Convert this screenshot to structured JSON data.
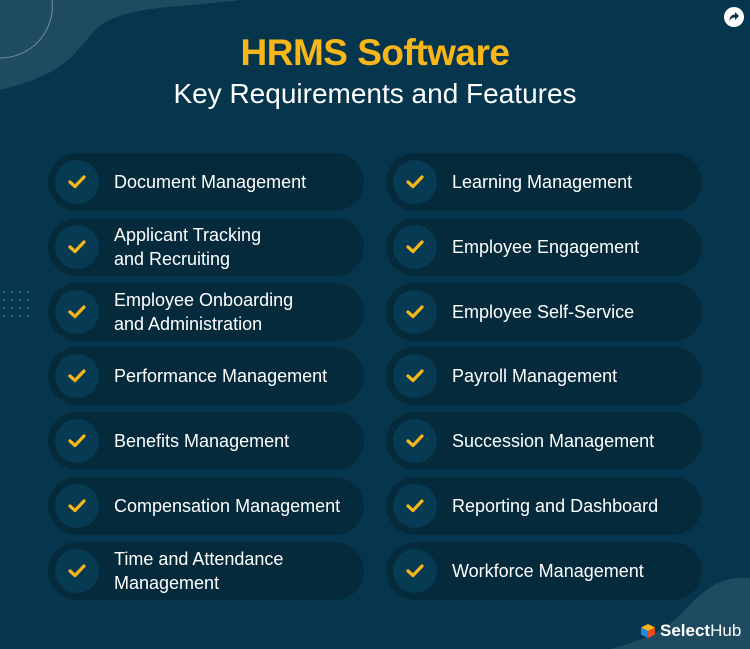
{
  "header": {
    "title": "HRMS Software",
    "subtitle": "Key Requirements and Features"
  },
  "icons": {
    "share": "share-arrow-icon",
    "check": "checkmark-icon",
    "logo": "selecthub-cube-icon"
  },
  "colors": {
    "background": "#06364d",
    "accent": "#f8b619",
    "pill": "#042a3c",
    "circle": "#073a53"
  },
  "features": {
    "left": [
      {
        "line1": "Document Management",
        "line2": ""
      },
      {
        "line1": "Applicant Tracking",
        "line2": "and Recruiting"
      },
      {
        "line1": "Employee Onboarding",
        "line2": "and Administration"
      },
      {
        "line1": "Performance Management",
        "line2": ""
      },
      {
        "line1": "Benefits Management",
        "line2": ""
      },
      {
        "line1": "Compensation Management",
        "line2": ""
      },
      {
        "line1": "Time and Attendance",
        "line2": "Management"
      }
    ],
    "right": [
      {
        "line1": "Learning Management",
        "line2": ""
      },
      {
        "line1": "Employee Engagement",
        "line2": ""
      },
      {
        "line1": "Employee Self-Service",
        "line2": ""
      },
      {
        "line1": "Payroll Management",
        "line2": ""
      },
      {
        "line1": "Succession Management",
        "line2": ""
      },
      {
        "line1": "Reporting and Dashboard",
        "line2": ""
      },
      {
        "line1": "Workforce Management",
        "line2": ""
      }
    ]
  },
  "brand": {
    "name_bold": "Select",
    "name_regular": "Hub"
  }
}
